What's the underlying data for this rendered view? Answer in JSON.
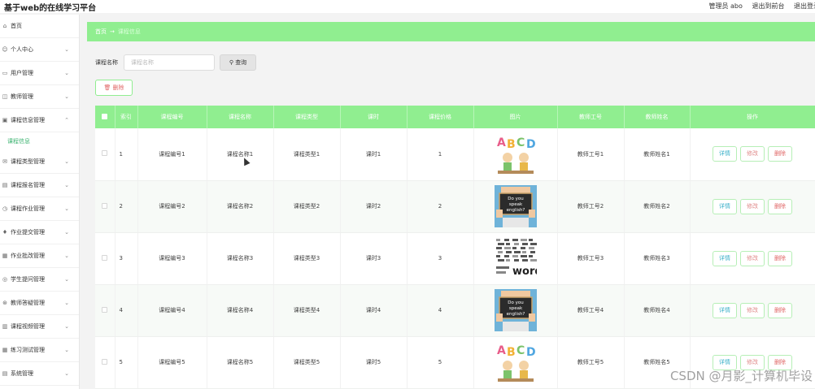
{
  "app": {
    "title": "基于web的在线学习平台",
    "user_label": "管理员 abo",
    "front_link": "退出到前台",
    "logout": "退出登录"
  },
  "sidebar": {
    "items": [
      {
        "label": "首页",
        "icon": "home-icon",
        "glyph": "⌂",
        "expand": false
      },
      {
        "label": "个人中心",
        "icon": "user-icon",
        "glyph": "☺",
        "expand": true
      },
      {
        "label": "用户管理",
        "icon": "chat-icon",
        "glyph": "▭",
        "expand": true
      },
      {
        "label": "教师管理",
        "icon": "teacher-icon",
        "glyph": "◫",
        "expand": true
      },
      {
        "label": "课程信息管理",
        "icon": "doc-icon",
        "glyph": "▣",
        "expand": "up"
      },
      {
        "label": "课程信息",
        "sub": true
      },
      {
        "label": "课程类型管理",
        "icon": "mail-icon",
        "glyph": "✉",
        "expand": true
      },
      {
        "label": "课程报名管理",
        "icon": "bag-icon",
        "glyph": "▤",
        "expand": true
      },
      {
        "label": "课程作业管理",
        "icon": "clock-icon",
        "glyph": "◷",
        "expand": true
      },
      {
        "label": "作业提交管理",
        "icon": "mic-icon",
        "glyph": "♦",
        "expand": true
      },
      {
        "label": "作业批改管理",
        "icon": "list-icon",
        "glyph": "▦",
        "expand": true
      },
      {
        "label": "学生提问管理",
        "icon": "question-icon",
        "glyph": "◎",
        "expand": true
      },
      {
        "label": "教师答疑管理",
        "icon": "answer-icon",
        "glyph": "⊛",
        "expand": true
      },
      {
        "label": "课程视频管理",
        "icon": "video-icon",
        "glyph": "▥",
        "expand": true
      },
      {
        "label": "练习测试管理",
        "icon": "grid-icon",
        "glyph": "▦",
        "expand": true
      },
      {
        "label": "系统管理",
        "icon": "settings-icon",
        "glyph": "▤",
        "expand": true
      }
    ]
  },
  "breadcrumb": {
    "home": "首页",
    "sep": "→",
    "current": "课程信息"
  },
  "search": {
    "label": "课程名称",
    "placeholder": "课程名称",
    "button": "查询",
    "button_icon": "search-icon"
  },
  "toolbar": {
    "delete_label": "删除",
    "delete_icon": "trash-icon"
  },
  "table": {
    "columns": [
      "",
      "索引",
      "课程编号",
      "课程名称",
      "课程类型",
      "课时",
      "课程价格",
      "图片",
      "教师工号",
      "教师姓名",
      "操作"
    ],
    "rows": [
      {
        "index": "1",
        "code": "课程编号1",
        "name": "课程名称1",
        "type": "课程类型1",
        "hours": "课时1",
        "price": "1",
        "image": "abcd-kids",
        "teacher_id": "教师工号1",
        "teacher_name": "教师姓名1"
      },
      {
        "index": "2",
        "code": "课程编号2",
        "name": "课程名称2",
        "type": "课程类型2",
        "hours": "课时2",
        "price": "2",
        "image": "do-you-speak-english",
        "teacher_id": "教师工号2",
        "teacher_name": "教师姓名2"
      },
      {
        "index": "3",
        "code": "课程编号3",
        "name": "课程名称3",
        "type": "课程类型3",
        "hours": "课时3",
        "price": "3",
        "image": "words-cloud",
        "teacher_id": "教师工号3",
        "teacher_name": "教师姓名3"
      },
      {
        "index": "4",
        "code": "课程编号4",
        "name": "课程名称4",
        "type": "课程类型4",
        "hours": "课时4",
        "price": "4",
        "image": "do-you-speak-english",
        "teacher_id": "教师工号4",
        "teacher_name": "教师姓名4"
      },
      {
        "index": "5",
        "code": "课程编号5",
        "name": "课程名称5",
        "type": "课程类型5",
        "hours": "课时5",
        "price": "5",
        "image": "abcd-kids",
        "teacher_id": "教师工号5",
        "teacher_name": "教师姓名5"
      }
    ],
    "actions": {
      "detail": "详情",
      "edit": "修改",
      "delete": "删除"
    },
    "image_text": {
      "abcd": [
        "A",
        "B",
        "C",
        "D"
      ],
      "speak": [
        "Do you",
        "speak",
        "english?"
      ],
      "words": "words"
    }
  },
  "watermark": "CSDN @月影_计算机毕设",
  "colors": {
    "accent": "#90ee90",
    "active_sub": "#3cb371",
    "detail": "#3bb0c9",
    "danger": "#e06666"
  }
}
